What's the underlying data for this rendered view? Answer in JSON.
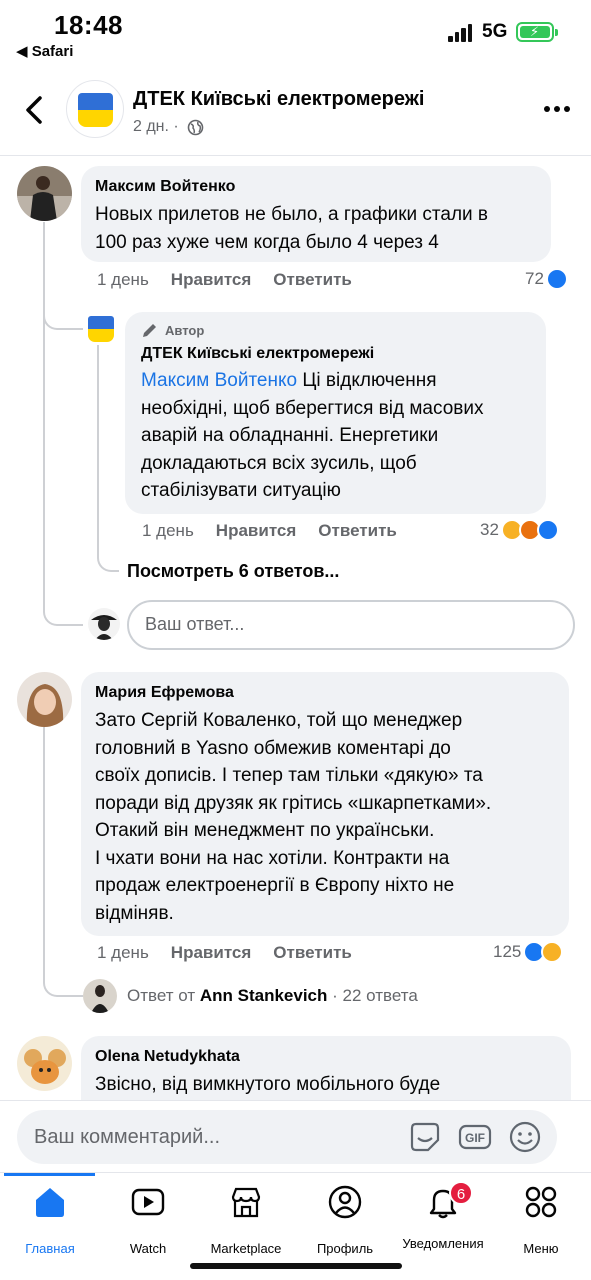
{
  "status_bar": {
    "time": "18:48",
    "back_app": "◀ Safari",
    "network": "5G"
  },
  "header": {
    "title": "ДТЕК Київські електромережі",
    "meta": "2 дн. ·"
  },
  "comments": [
    {
      "name": "Максим Войтенко",
      "text": "Новых прилетов не было, а графики стали в\n100 раз хуже чем когда было 4 через 4",
      "time": "1 день",
      "like": "Нравится",
      "reply": "Ответить",
      "count": "72"
    },
    {
      "badge": "Автор",
      "name": "ДТЕК Київські електромережі",
      "mention": "Максим Войтенко",
      "text": " Ці відключення\nнеобхідні, щоб вберегтися від масових\nаварій на обладнанні. Енергетики\nдокладаються всіх зусиль, щоб\nстабілізувати ситуацію",
      "time": "1 день",
      "like": "Нравится",
      "reply": "Ответить",
      "count": "32"
    },
    {
      "name": "Мария Ефремова",
      "text": "Зато Сергій Коваленко, той що менеджер\nголовний  в Yasno обмежив коментарі до\nсвоїх дописів. І тепер там тільки «дякую» та\nпоради від друзяк як грітись «шкарпетками».\nОтакий він менеджмент по українськи.\nІ чхати вони на нас хотіли. Контракти на\nпродаж електроенергії в Європу ніхто не\nвідміняв.",
      "time": "1 день",
      "like": "Нравится",
      "reply": "Ответить",
      "count": "125"
    },
    {
      "name": "Olena Netudykhata",
      "text": "Звісно, від вимкнутого мобільного буде"
    }
  ],
  "view_replies": "Посмотреть 6 ответов...",
  "reply_placeholder": "Ваш ответ...",
  "reply_summary": {
    "prefix": "Ответ от ",
    "author": "Ann Stankevich",
    "suffix": " · 22 ответа"
  },
  "composer": {
    "placeholder": "Ваш комментарий...",
    "gif": "GIF"
  },
  "tabs": [
    {
      "label": "Главная",
      "icon": "home-icon"
    },
    {
      "label": "Watch",
      "icon": "video-icon"
    },
    {
      "label": "Marketplace",
      "icon": "shop-icon"
    },
    {
      "label": "Профиль",
      "icon": "profile-icon"
    },
    {
      "label": "Уведомления",
      "icon": "bell-icon",
      "badge": "6"
    },
    {
      "label": "Меню",
      "icon": "grid-icon"
    }
  ],
  "colors": {
    "accent": "#1877f2",
    "bubble": "#f0f2f5",
    "badge": "#e41e3f",
    "flag_blue": "#2f6fd6",
    "flag_yellow": "#ffd500"
  }
}
